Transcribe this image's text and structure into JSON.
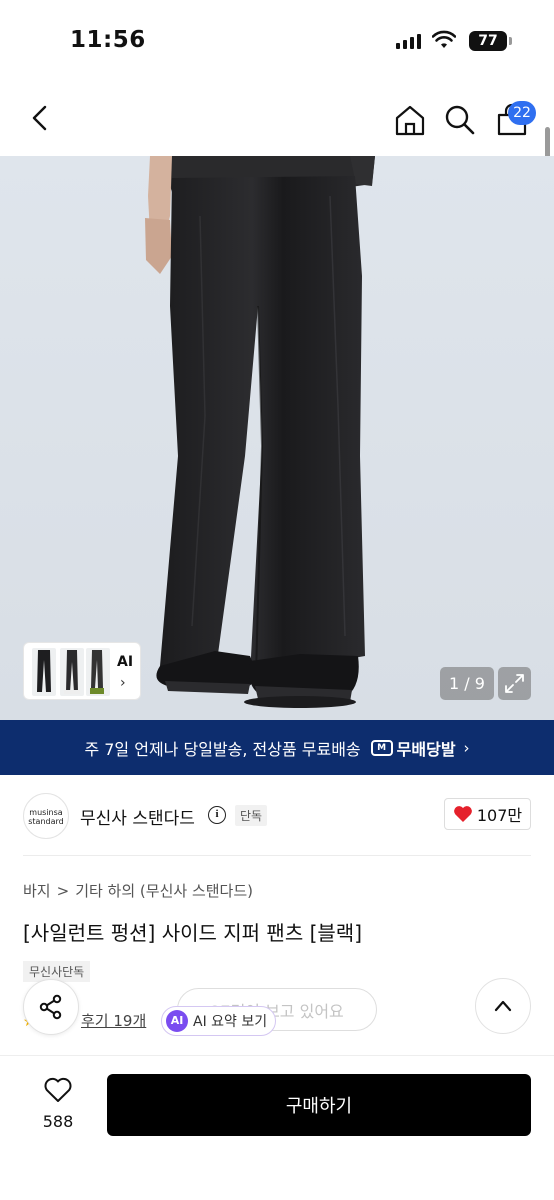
{
  "status_bar": {
    "time": "11:56",
    "battery": "77"
  },
  "header": {
    "cart_count": "22"
  },
  "gallery": {
    "ai_label": "AI",
    "pager": "1 / 9"
  },
  "promo": {
    "text": "주 7일 언제나 당일발송, 전상품 무료배송",
    "logo_text": "무배당발",
    "logo_badge": "M"
  },
  "brand": {
    "logo_line1": "musinsa",
    "logo_line2": "standard",
    "name": "무신사 스탠다드",
    "info_icon": "i",
    "exclusive_tag": "단독",
    "likes": "107만"
  },
  "breadcrumb": {
    "items": [
      "바지",
      "기타 하의 (무신사 스탠다드)"
    ],
    "separator": ">"
  },
  "product": {
    "title": "[사일런트 펑션] 사이드 지퍼 팬츠 [블랙]",
    "tag": "무신사단독",
    "reviews": "후기 19개"
  },
  "ai_summary": {
    "badge": "AI",
    "label": "AI 요약 보기"
  },
  "viewers": {
    "text": "27명이 보고 있어요"
  },
  "bottom_bar": {
    "wish_count": "588",
    "buy_label": "구매하기"
  },
  "colors": {
    "banner": "#0d2d6e",
    "badge": "#2f6ff0",
    "heart": "#e5212c",
    "ai": "#7a4cf0",
    "buy": "#000000"
  }
}
